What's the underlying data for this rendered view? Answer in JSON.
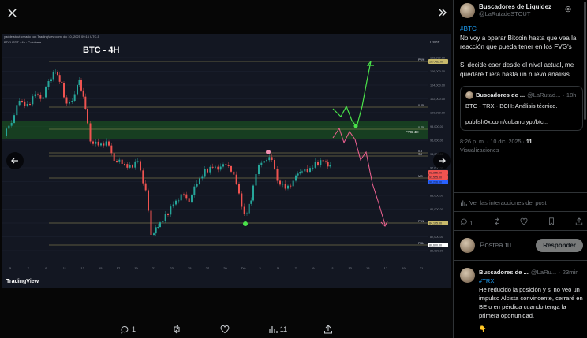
{
  "viewer": {
    "close_icon": "close-icon",
    "collapse_icon": "double-chevron-right-icon",
    "prev_icon": "arrow-left-icon",
    "next_icon": "arrow-right-icon",
    "actions": {
      "replies": "1",
      "reposts": "",
      "likes": "",
      "views": "11"
    }
  },
  "chart": {
    "header_text": "yaddelstout creado con TradingView.com, dic 10, 2025 09:16 UTC-5",
    "symbol_text": "BTCUSDT · 4h · Coinbase",
    "currency": "USDT",
    "title": "BTC - 4H",
    "fvg_label": "FVG-4H",
    "brand": "TradingView",
    "price_ticks": [
      "108,000.00",
      "106,000.00",
      "104,000.00",
      "102,000.00",
      "100,000.00",
      "98,000.00",
      "96,000.00",
      "94,000.00",
      "92,000.00",
      "90,000.00",
      "88,000.00",
      "86,000.00",
      "84,000.00",
      "82,000.00",
      "80,000.00"
    ],
    "level_labels": [
      "PWH",
      "0.25",
      "0.75",
      "0.5",
      "SO",
      "MO",
      "PWL",
      "PML"
    ],
    "price_tags": [
      "107,465.00",
      "92,855.00",
      "91,555.00",
      "90,226.00",
      "84,105.00",
      "80,600.00"
    ],
    "date_ticks": [
      "5",
      "7",
      "9",
      "11",
      "13",
      "15",
      "17",
      "19",
      "21",
      "23",
      "25",
      "27",
      "29",
      "Dic",
      "3",
      "5",
      "7",
      "9",
      "11",
      "13",
      "15",
      "17",
      "19",
      "21"
    ],
    "colors": {
      "bull": "#26a69a",
      "bear": "#ef5350",
      "fvg": "#1b5e20",
      "up_path": "#4ae34a",
      "down_path": "#f06292",
      "level": "#c8b96b"
    }
  },
  "post": {
    "author_name": "Buscadores de Liquidez",
    "author_handle": "@LaRutadeSTOUT",
    "hashtag": "#BTC",
    "text": "No voy a operar Bitcoin hasta que vea la reacción que pueda tener en los FVG's\n\nSi decide caer desde el nivel actual, me quedaré fuera hasta un nuevo análisis.",
    "quote": {
      "author_name": "Buscadores de ...",
      "author_handle": "@LaRutad...",
      "age": "· 18h",
      "text": "BTC - TRX - BCH: Análisis técnico.",
      "link": "publish0x.com/cubancrypt/btc..."
    },
    "timestamp": "8:26 p. m. · 10 dic. 2025 ·",
    "views_count": "11",
    "views_label": "Visualizaciones",
    "interactions_link": "Ver las interacciones del post",
    "stats": {
      "replies": "1",
      "reposts": "",
      "likes": "",
      "bookmarks": ""
    }
  },
  "composer": {
    "placeholder": "Postea tu",
    "reply_button": "Responder"
  },
  "reply": {
    "author_name": "Buscadores de ...",
    "author_handle": "@LaRu...",
    "age": "· 23min",
    "hashtag": "#TRX",
    "text": "He reducido la posición y si no veo un impulso Alcista convincente, cerraré en BE o en pérdida cuando tenga la primera oportunidad.",
    "emoji": "👇"
  }
}
